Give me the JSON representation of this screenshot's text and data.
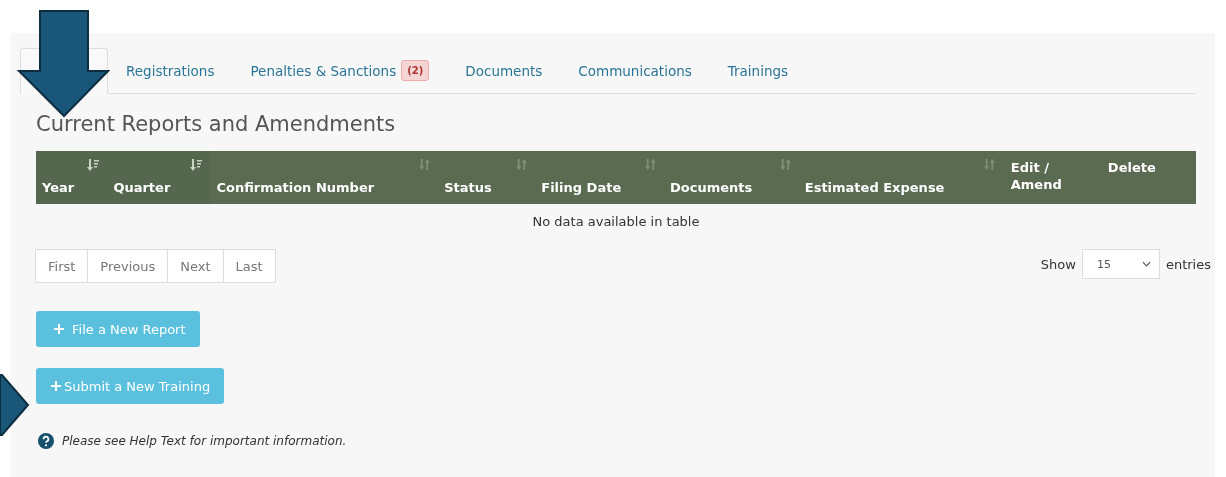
{
  "tabs": [
    {
      "label": "Registrations",
      "selected": false
    },
    {
      "label": "Penalties & Sanctions",
      "badge": "(2)",
      "selected": false
    },
    {
      "label": "Documents",
      "selected": false
    },
    {
      "label": "Communications",
      "selected": false
    },
    {
      "label": "Trainings",
      "selected": false
    }
  ],
  "heading": "Current Reports and Amendments",
  "table": {
    "columns": [
      {
        "label": "Year",
        "sortable": true,
        "sorted": true
      },
      {
        "label": "Quarter",
        "sortable": true,
        "sorted": true
      },
      {
        "label": "Confirmation Number",
        "sortable": true,
        "sorted": false
      },
      {
        "label": "Status",
        "sortable": true,
        "sorted": false
      },
      {
        "label": "Filing Date",
        "sortable": true,
        "sorted": false
      },
      {
        "label": "Documents",
        "sortable": true,
        "sorted": false
      },
      {
        "label": "Estimated Expense",
        "sortable": true,
        "sorted": false
      },
      {
        "label": "Edit / Amend",
        "sortable": false
      },
      {
        "label": "Delete",
        "sortable": false
      }
    ],
    "empty_message": "No data available in table"
  },
  "pager": [
    "First",
    "Previous",
    "Next",
    "Last"
  ],
  "length_menu": {
    "prefix": "Show",
    "value": "15",
    "suffix": "entries"
  },
  "buttons": [
    {
      "label": "File a New Report"
    },
    {
      "label": "Submit a New Training"
    }
  ],
  "help": "Please see Help Text for important information."
}
